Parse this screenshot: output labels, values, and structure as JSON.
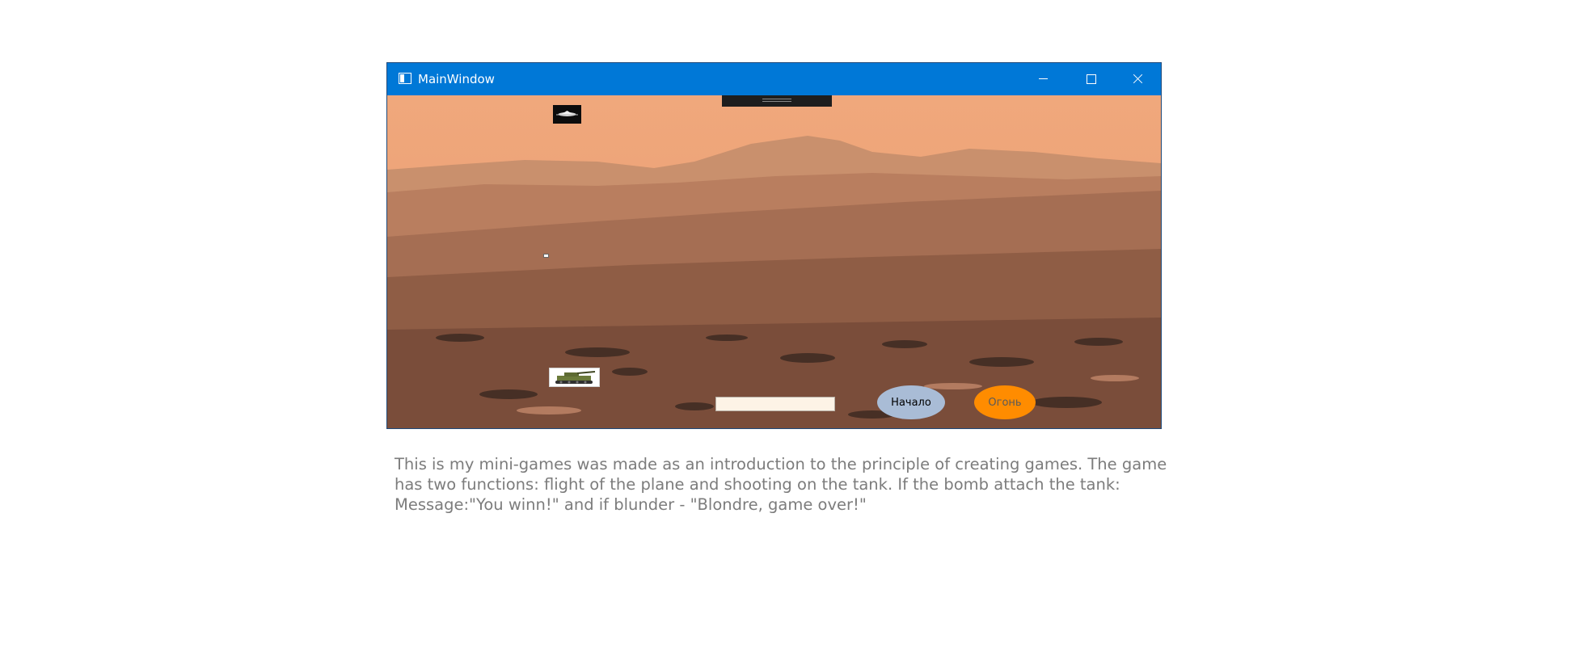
{
  "window": {
    "title": "MainWindow",
    "controls": {
      "minimize_icon": "minimize-icon",
      "maximize_icon": "maximize-icon",
      "close_icon": "close-icon"
    },
    "titlebar_color": "#0078d7"
  },
  "game": {
    "message_box_value": "",
    "start_button_label": "Начало",
    "fire_button_label": "Огонь",
    "start_button_color": "#a9bcd6",
    "fire_button_color": "#ff8c00"
  },
  "description": {
    "text": "This is my mini-games was made as an introduction to the principle of creating games. The game has two functions: flight of the plane and shooting on the tank. If the bomb attach the tank: Message:\"You winn!\" and if blunder - \"Blondre, game over!\""
  }
}
